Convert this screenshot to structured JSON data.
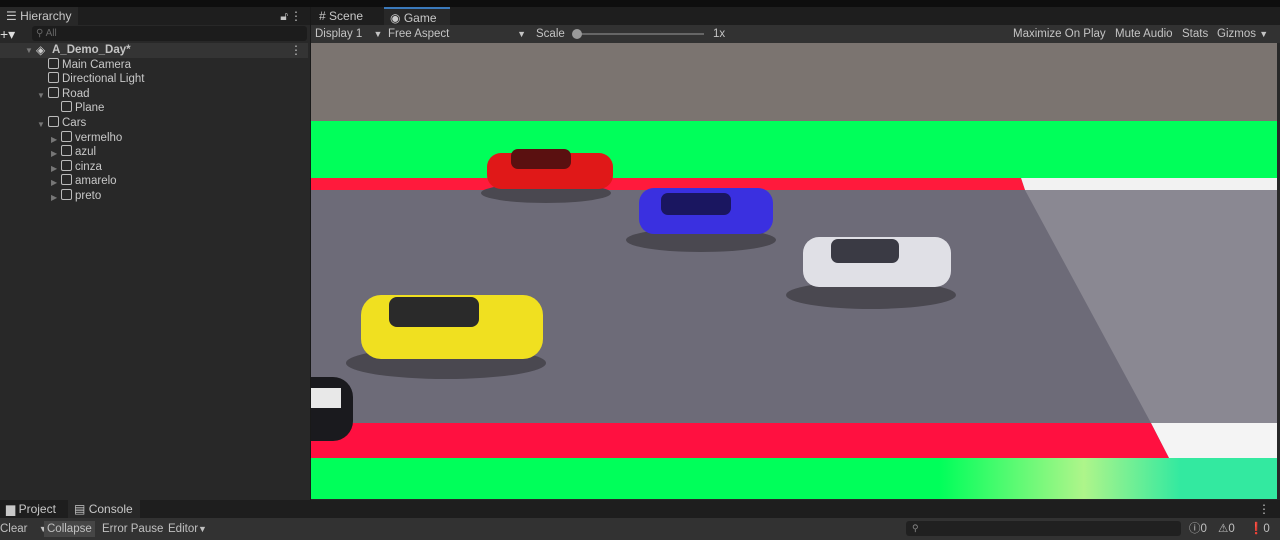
{
  "hierarchy": {
    "title": "Hierarchy",
    "search_placeholder": "All",
    "scene": "A_Demo_Day*",
    "items": [
      {
        "label": "Main Camera"
      },
      {
        "label": "Directional Light"
      },
      {
        "label": "Road"
      },
      {
        "label": "Plane"
      },
      {
        "label": "Cars"
      },
      {
        "label": "vermelho"
      },
      {
        "label": "azul"
      },
      {
        "label": "cinza"
      },
      {
        "label": "amarelo"
      },
      {
        "label": "preto"
      }
    ]
  },
  "game": {
    "tabs": {
      "scene": "Scene",
      "game": "Game"
    },
    "toolbar": {
      "display": "Display 1",
      "aspect": "Free Aspect",
      "scale_label": "Scale",
      "scale_value": "1x",
      "maximize": "Maximize On Play",
      "mute": "Mute Audio",
      "stats": "Stats",
      "gizmos": "Gizmos"
    },
    "scale_fraction": 0
  },
  "console": {
    "tabs": {
      "project": "Project",
      "console": "Console"
    },
    "clear": "Clear",
    "collapse": "Collapse",
    "error_pause": "Error Pause",
    "editor": "Editor",
    "counts": {
      "logs": "0",
      "warnings": "0",
      "errors": "0"
    }
  },
  "colors": {
    "green": "#00ff5a",
    "red": "#ff1040",
    "road": "#6c6a78",
    "backdrop": "#7a7470"
  }
}
